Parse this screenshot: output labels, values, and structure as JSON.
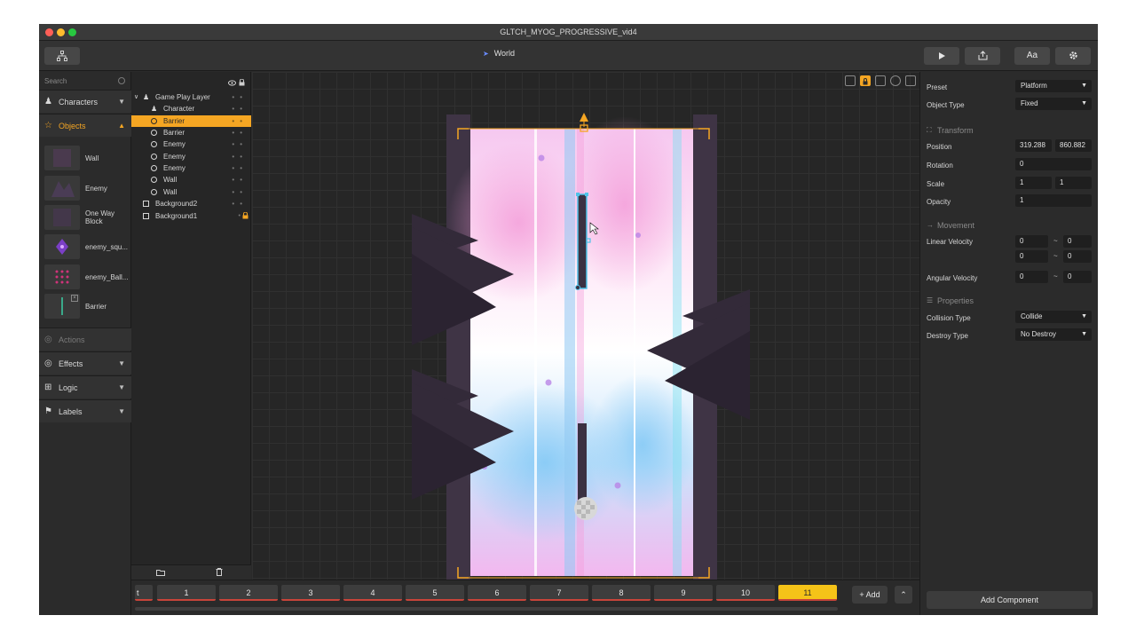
{
  "window": {
    "title": "GLTCH_MYOG_PROGRESSIVE_vid4"
  },
  "toolbar": {
    "world_label": "World",
    "font_button": "Aa"
  },
  "sidebar": {
    "search_placeholder": "Search",
    "categories": {
      "characters": "Characters",
      "objects": "Objects",
      "actions": "Actions",
      "effects": "Effects",
      "logic": "Logic",
      "labels": "Labels"
    },
    "objects": [
      "Wall",
      "Enemy",
      "One Way Block",
      "enemy_squ...",
      "enemy_Ball...",
      "Barrier"
    ]
  },
  "layers": {
    "root": "Game Play Layer",
    "items": [
      "Character",
      "Barrier",
      "Barrier",
      "Enemy",
      "Enemy",
      "Enemy",
      "Wall",
      "Wall"
    ],
    "backgrounds": [
      "Background2",
      "Background1"
    ]
  },
  "inspector": {
    "preset_label": "Preset",
    "preset_value": "Platform",
    "object_type_label": "Object Type",
    "object_type_value": "Fixed",
    "transform_label": "Transform",
    "position_label": "Position",
    "position_x": "319.288",
    "position_y": "860.882",
    "rotation_label": "Rotation",
    "rotation_value": "0",
    "scale_label": "Scale",
    "scale_x": "1",
    "scale_y": "1",
    "opacity_label": "Opacity",
    "opacity_value": "1",
    "movement_label": "Movement",
    "linear_velocity_label": "Linear Velocity",
    "lv1_a": "0",
    "lv1_b": "0",
    "lv2_a": "0",
    "lv2_b": "0",
    "angular_velocity_label": "Angular Velocity",
    "av_a": "0",
    "av_b": "0",
    "properties_label": "Properties",
    "collision_type_label": "Collision Type",
    "collision_type_value": "Collide",
    "destroy_type_label": "Destroy Type",
    "destroy_type_value": "No Destroy",
    "tilde": "~",
    "add_component": "Add Component"
  },
  "timeline": {
    "partial_label": "t",
    "steps": [
      "1",
      "2",
      "3",
      "4",
      "5",
      "6",
      "7",
      "8",
      "9",
      "10",
      "11"
    ],
    "active_step": "11",
    "add_label": "+ Add"
  },
  "colors": {
    "accent": "#f5a623",
    "step_active": "#f5c318",
    "selection": "#4fc3e8"
  }
}
